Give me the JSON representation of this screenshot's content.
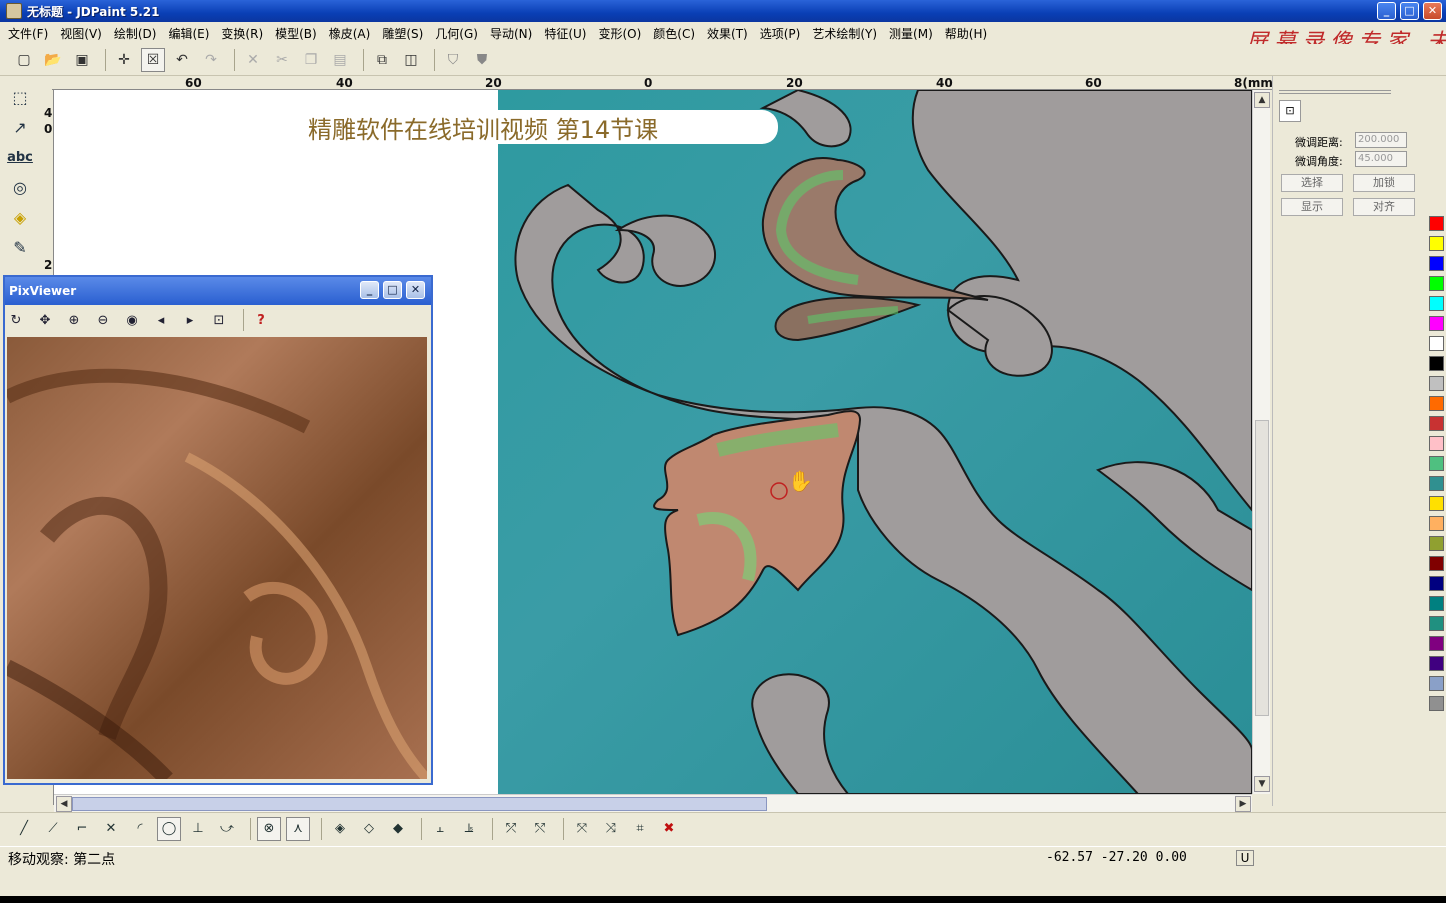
{
  "window": {
    "title": "无标题 - JDPaint 5.21",
    "min": "_",
    "max": "□",
    "close": "✕"
  },
  "menu": [
    "文件(F)",
    "视图(V)",
    "绘制(D)",
    "编辑(E)",
    "变换(R)",
    "模型(B)",
    "橡皮(A)",
    "雕塑(S)",
    "几何(G)",
    "导动(N)",
    "特征(U)",
    "变形(O)",
    "颜色(C)",
    "效果(T)",
    "选项(P)",
    "艺术绘制(Y)",
    "测量(M)",
    "帮助(H)"
  ],
  "watermark": "屏幕录像专家 未",
  "toolbar": {
    "icons": [
      "new-icon",
      "open-icon",
      "save-icon",
      "crosshair-icon",
      "select-box-icon",
      "undo-icon",
      "redo-icon",
      "cut-icon",
      "scissors-icon",
      "copy-icon",
      "paste-icon",
      "cube-icon",
      "view-icon",
      "shield-icon",
      "shield2-icon"
    ]
  },
  "ruler": {
    "h_labels": [
      "60",
      "40",
      "20",
      "0",
      "20",
      "40",
      "60",
      "8(mm"
    ],
    "v_labels": [
      "4",
      "0",
      "2"
    ]
  },
  "banner": {
    "text": "精雕软件在线培训视频 第14节课"
  },
  "pixviewer": {
    "title": "PixViewer",
    "min": "_",
    "max": "□",
    "close": "✕",
    "help": "?"
  },
  "rightpanel": {
    "label_distance": "微调距离:",
    "label_angle": "微调角度:",
    "value_distance": "200.000",
    "value_angle": "45.000",
    "btn_select": "选择",
    "btn_lock": "加锁",
    "btn_show": "显示",
    "btn_align": "对齐"
  },
  "palette": [
    "#ff0000",
    "#ffff00",
    "#0000ff",
    "#00ff00",
    "#00ffff",
    "#ff00ff",
    "#ffffff",
    "#000000",
    "#c0c0c0",
    "#ff6a00",
    "#c83232",
    "#ffc0c8",
    "#4fc080",
    "#309090",
    "#ffe000",
    "#ffb060",
    "#90a030",
    "#800000",
    "#000080",
    "#008080",
    "#209080",
    "#800080",
    "#400080",
    "#8aa0c8",
    "#909090"
  ],
  "status": {
    "text": "移动观察: 第二点",
    "coords": "-62.57 -27.20 0.00",
    "unit": "U"
  }
}
